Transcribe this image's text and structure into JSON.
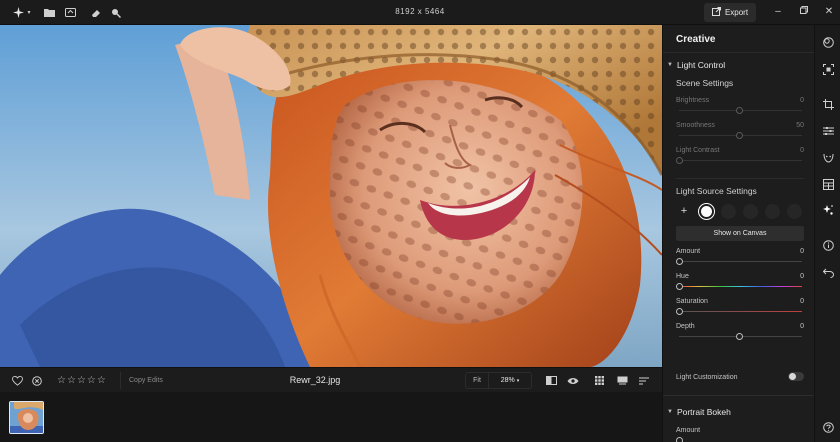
{
  "topbar": {
    "image_dimensions": "8192 x 5464",
    "export_label": "Export",
    "icons": [
      "logo-star-icon",
      "chevron-down-icon",
      "folder-icon",
      "import-icon",
      "eraser-icon",
      "search-icon",
      "export-icon",
      "minimize-icon",
      "restore-icon",
      "close-icon"
    ]
  },
  "bottombar": {
    "copy_edits_label": "Copy Edits",
    "filename": "Rewr_32.jpg",
    "zoom_fit_label": "Fit",
    "zoom_value": "28%",
    "rating_stars": 5,
    "rating_value": 0
  },
  "panel": {
    "title": "Creative",
    "light_control": {
      "header": "Light Control",
      "scene_settings": {
        "header": "Scene Settings",
        "sliders": [
          {
            "label": "Brightness",
            "value": "0",
            "level": 0.5
          },
          {
            "label": "Smoothness",
            "value": "50",
            "level": 0.5
          },
          {
            "label": "Light Contrast",
            "value": "0",
            "level": 0.0
          }
        ]
      },
      "light_source_settings": {
        "header": "Light Source Settings",
        "show_on_canvas_label": "Show on Canvas",
        "sliders": [
          {
            "label": "Amount",
            "value": "0",
            "level": 0.0
          },
          {
            "label": "Hue",
            "value": "0",
            "level": 0.0
          },
          {
            "label": "Saturation",
            "value": "0",
            "level": 0.0
          },
          {
            "label": "Depth",
            "value": "0",
            "level": 0.5
          }
        ]
      },
      "light_customization_label": "Light Customization",
      "light_customization_on": false
    },
    "portrait_bokeh": {
      "header": "Portrait Bokeh",
      "amount_label": "Amount"
    }
  },
  "rail": {
    "icons": [
      "layers-icon",
      "select-icon",
      "crop-icon",
      "sliders-icon",
      "face-icon",
      "presets-icon",
      "creative-sparkle-icon",
      "info-icon",
      "undo-icon",
      "help-icon"
    ]
  },
  "colors": {
    "accent": "#ffffff",
    "panel_bg": "#1d1d1d",
    "app_bg": "#141414"
  }
}
